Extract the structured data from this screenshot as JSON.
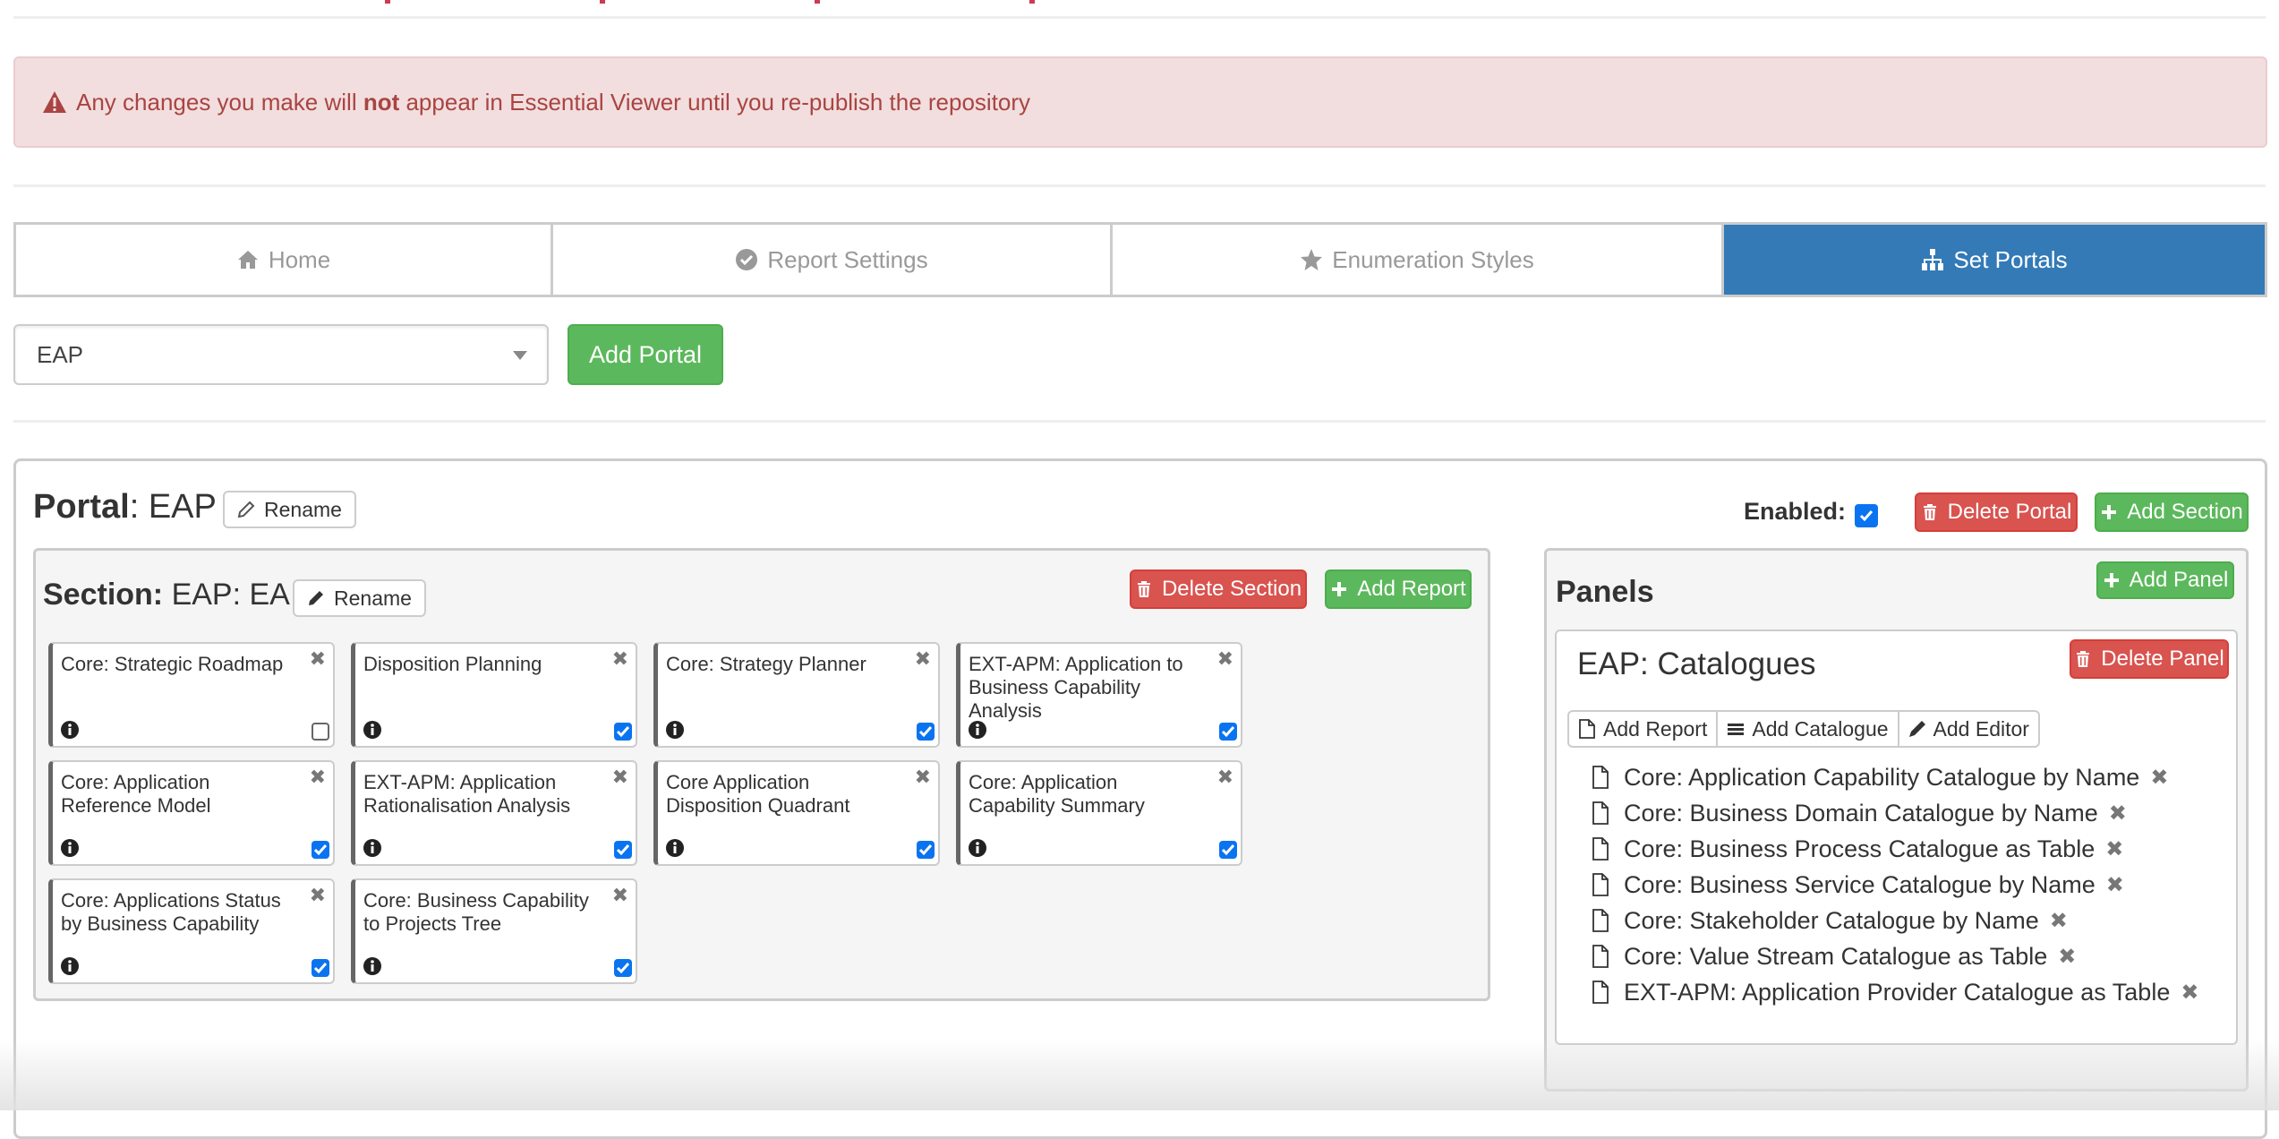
{
  "alert": {
    "icon": "warning-triangle-icon",
    "text_before": "Any changes you make will ",
    "text_bold": "not",
    "text_after": " appear in Essential Viewer until you re-publish the repository"
  },
  "tabs": [
    {
      "label": "Home",
      "icon": "home-icon",
      "active": false
    },
    {
      "label": "Report Settings",
      "icon": "check-circle-icon",
      "active": false
    },
    {
      "label": "Enumeration Styles",
      "icon": "star-icon",
      "active": false
    },
    {
      "label": "Set Portals",
      "icon": "sitemap-icon",
      "active": true
    }
  ],
  "portal_select": {
    "value": "EAP"
  },
  "add_portal_label": "Add Portal",
  "portal": {
    "label": "Portal",
    "name": ": EAP",
    "rename_label": "Rename",
    "enabled_label": "Enabled:",
    "enabled": true,
    "delete_label": "Delete Portal",
    "add_section_label": "Add Section"
  },
  "section": {
    "label": "Section:",
    "name": " EAP: EA",
    "rename_label": "Rename",
    "delete_label": "Delete Section",
    "add_report_label": "Add Report",
    "reports": [
      {
        "title": "Core: Strategic Roadmap",
        "enabled": false
      },
      {
        "title": "Disposition Planning",
        "enabled": true
      },
      {
        "title": "Core: Strategy Planner",
        "enabled": true
      },
      {
        "title": "EXT-APM: Application to Business Capability Analysis",
        "enabled": true
      },
      {
        "title": "Core: Application Reference Model",
        "enabled": true
      },
      {
        "title": "EXT-APM: Application Rationalisation Analysis",
        "enabled": true
      },
      {
        "title": "Core Application Disposition Quadrant",
        "enabled": true
      },
      {
        "title": "Core: Application Capability Summary",
        "enabled": true
      },
      {
        "title": "Core: Applications Status by Business Capability",
        "enabled": true
      },
      {
        "title": "Core: Business Capability to Projects Tree",
        "enabled": true
      }
    ]
  },
  "panels": {
    "title": "Panels",
    "add_panel_label": "Add Panel",
    "panel": {
      "name": "EAP: Catalogues",
      "delete_label": "Delete Panel",
      "toolbar": [
        {
          "label": "Add Report",
          "icon": "file-icon"
        },
        {
          "label": "Add Catalogue",
          "icon": "list-icon"
        },
        {
          "label": "Add Editor",
          "icon": "pencil-icon"
        }
      ],
      "items": [
        "Core: Application Capability Catalogue by Name",
        "Core: Business Domain Catalogue by Name",
        "Core: Business Process Catalogue as Table",
        "Core: Business Service Catalogue by Name",
        "Core: Stakeholder Catalogue by Name",
        "Core: Value Stream Catalogue as Table",
        "EXT-APM: Application Provider Catalogue as Table"
      ]
    }
  },
  "colors": {
    "primary": "#337ab7",
    "success": "#5cb85c",
    "danger": "#d9534f",
    "alert_bg": "#f2dede",
    "alert_text": "#a94442",
    "checkbox": "#0a74f0"
  }
}
